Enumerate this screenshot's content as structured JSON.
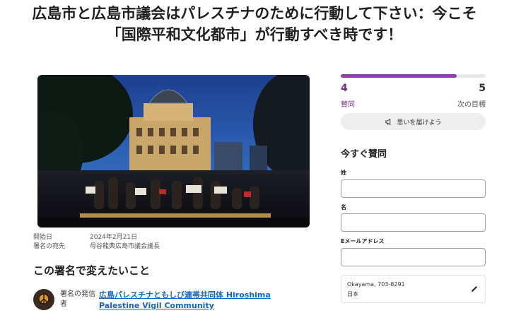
{
  "title": {
    "line1": "広島市と広島市議会はパレスチナのために行動して下さい：今こそ",
    "line2": "「国際平和文化都市」が行動すべき時です！"
  },
  "meta": {
    "start_label": "開始日",
    "start_value": "2024年2月21日",
    "target_label": "署名の宛先",
    "target_value": "母谷龍典広島市議会議長"
  },
  "section": {
    "heading": "この署名で変えたいこと"
  },
  "starter": {
    "role": "署名の発信者",
    "org": "広島パレスチナともしび連帯共同体 Hiroshima Palestine Vigil Community"
  },
  "signatures": {
    "count": "4",
    "count_label": "賛同",
    "goal": "5",
    "goal_label": "次の目標",
    "progress_fraction": 0.8
  },
  "share_button": {
    "label": "思いを届けよう",
    "icon": "megaphone-icon"
  },
  "form": {
    "title": "今すぐ賛同",
    "last_name_label": "姓",
    "first_name_label": "名",
    "email_label": "Eメールアドレス",
    "location_line1": "Okayama, 703-8291",
    "location_line2": "日本",
    "edit_icon": "pencil-icon"
  },
  "colors": {
    "accent": "#8e3fa0",
    "link": "#1565c0"
  }
}
